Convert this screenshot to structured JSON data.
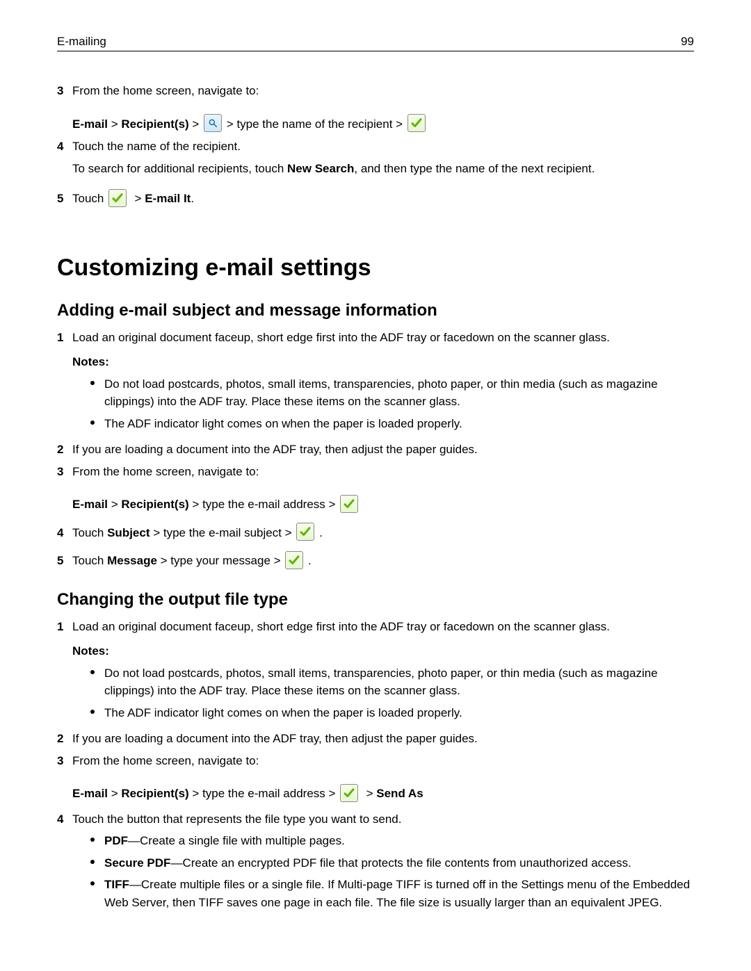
{
  "header": {
    "title": "E-mailing",
    "page": "99"
  },
  "earlier": {
    "step3": {
      "num": "3",
      "intro": "From the home screen, navigate to:",
      "nav_a": "E-mail",
      "nav_b": "Recipient(s)",
      "nav_c": "type the name of the recipient"
    },
    "step4": {
      "num": "4",
      "line1": "Touch the name of the recipient.",
      "line2a": "To search for additional recipients, touch ",
      "line2b": "New Search",
      "line2c": ", and then type the name of the next recipient."
    },
    "step5": {
      "num": "5",
      "a": "Touch ",
      "b": "E‑mail It",
      "c": "."
    }
  },
  "h1": "Customizing e‑mail settings",
  "sectionA": {
    "title": "Adding e‑mail subject and message information",
    "step1": {
      "num": "1",
      "text": "Load an original document faceup, short edge first into the ADF tray or facedown on the scanner glass.",
      "notes_label": "Notes:",
      "note1": "Do not load postcards, photos, small items, transparencies, photo paper, or thin media (such as magazine clippings) into the ADF tray. Place these items on the scanner glass.",
      "note2": "The ADF indicator light comes on when the paper is loaded properly."
    },
    "step2": {
      "num": "2",
      "text": "If you are loading a document into the ADF tray, then adjust the paper guides."
    },
    "step3": {
      "num": "3",
      "intro": "From the home screen, navigate to:",
      "nav_a": "E‑mail",
      "nav_b": "Recipient(s)",
      "nav_c": "type the e‑mail address"
    },
    "step4": {
      "num": "4",
      "a": "Touch ",
      "b": "Subject",
      "c": " > type the e‑mail subject > ",
      "d": " ."
    },
    "step5": {
      "num": "5",
      "a": "Touch ",
      "b": "Message",
      "c": " > type your message > ",
      "d": " ."
    }
  },
  "sectionB": {
    "title": "Changing the output file type",
    "step1": {
      "num": "1",
      "text": "Load an original document faceup, short edge first into the ADF tray or facedown on the scanner glass.",
      "notes_label": "Notes:",
      "note1": "Do not load postcards, photos, small items, transparencies, photo paper, or thin media (such as magazine clippings) into the ADF tray. Place these items on the scanner glass.",
      "note2": "The ADF indicator light comes on when the paper is loaded properly."
    },
    "step2": {
      "num": "2",
      "text": "If you are loading a document into the ADF tray, then adjust the paper guides."
    },
    "step3": {
      "num": "3",
      "intro": "From the home screen, navigate to:",
      "nav_a": "E‑mail",
      "nav_b": "Recipient(s)",
      "nav_c": "type the e‑mail address",
      "nav_d": "Send As"
    },
    "step4": {
      "num": "4",
      "text": "Touch the button that represents the file type you want to send.",
      "opt1a": "PDF",
      "opt1b": "—Create a single file with multiple pages.",
      "opt2a": "Secure PDF",
      "opt2b": "—Create an encrypted PDF file that protects the file contents from unauthorized access.",
      "opt3a": "TIFF",
      "opt3b": "—Create multiple files or a single file. If Multi-page TIFF is turned off in the Settings menu of the Embedded Web Server, then TIFF saves one page in each file. The file size is usually larger than an equivalent JPEG."
    }
  }
}
